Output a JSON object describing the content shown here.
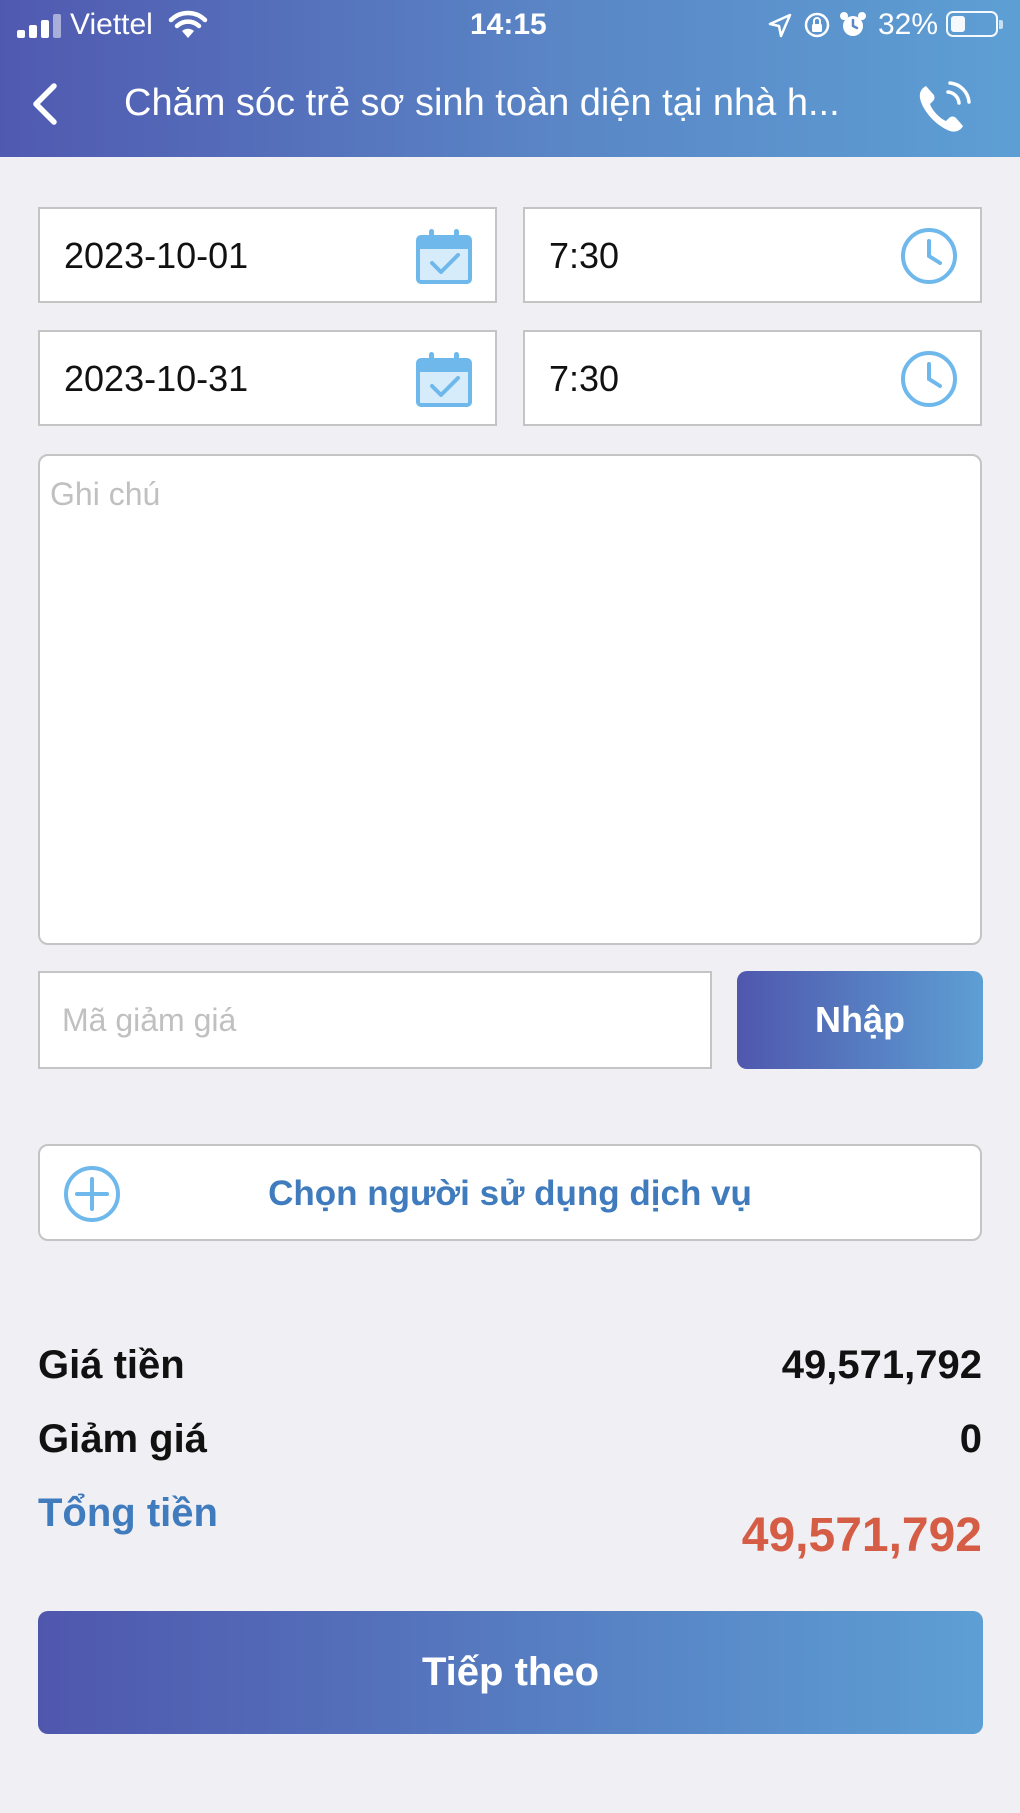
{
  "status_bar": {
    "carrier": "Viettel",
    "time": "14:15",
    "battery": "32%"
  },
  "header": {
    "title": "Chăm sóc trẻ sơ sinh toàn diện tại nhà h..."
  },
  "form": {
    "start_date": "2023-10-01",
    "start_time": "7:30",
    "end_date": "2023-10-31",
    "end_time": "7:30",
    "note_placeholder": "Ghi chú",
    "coupon_placeholder": "Mã giảm giá",
    "apply_label": "Nhập",
    "choose_user_label": "Chọn người sử dụng dịch vụ"
  },
  "summary": {
    "price_label": "Giá tiền",
    "price_value": "49,571,792",
    "discount_label": "Giảm giá",
    "discount_value": "0",
    "total_label": "Tổng tiền",
    "total_value": "49,571,792"
  },
  "actions": {
    "next_label": "Tiếp theo"
  },
  "colors": {
    "accent_blue": "#3f7bbd",
    "total_red": "#d65d45",
    "gradient_start": "#4f57ad",
    "gradient_end": "#5d9fd4",
    "icon_blue": "#6fb8ec"
  }
}
